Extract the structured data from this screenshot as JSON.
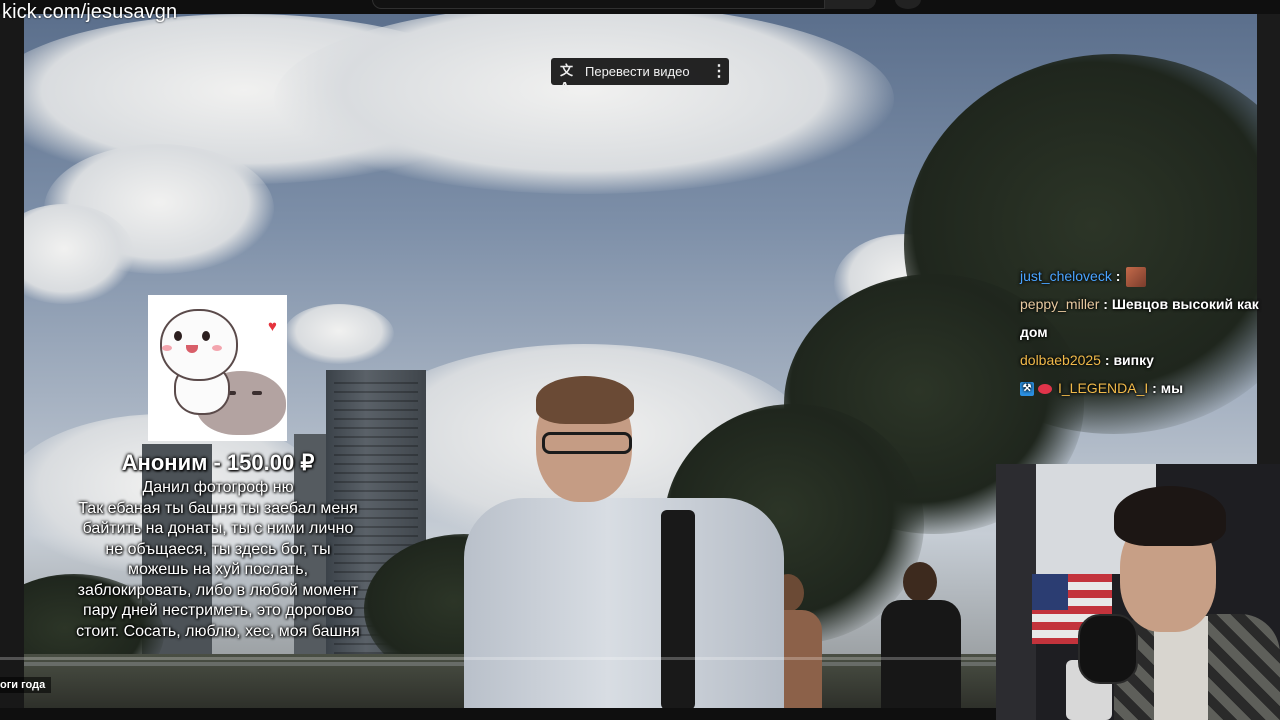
{
  "overlay": {
    "channel_url": "kick.com/jesusavgn"
  },
  "player": {
    "translate_button": {
      "icon": "translate-icon",
      "label": "Перевести видео",
      "menu_icon": "more-vert-icon"
    },
    "chapter_label": "оги года",
    "progress_fraction": 0.0
  },
  "donation": {
    "image": "cute-cats-sticker",
    "title": "Аноним - 150.00 ₽",
    "message": "Данил фотогроф ню\nТак ебаная ты башня ты заебал меня\nбайтить на донаты, ты с ними лично\nне объщаеся, ты здесь бог, ты\nможешь на хуй послать,\nзаблокировать, либо в любой момент\nпару дней нестриметь, это дорогово\nстоит. Сосать, люблю, хес, моя башня"
  },
  "chat": {
    "messages": [
      {
        "user": "just_cheloveck",
        "color": "#4aa3ff",
        "sep": " : ",
        "text": "",
        "emote": "face-emote"
      },
      {
        "user": "peppy_miller",
        "color": "#e8c9a0",
        "sep": " : ",
        "text": "Шевцов высокий как дом"
      },
      {
        "user": "dolbaeb2025",
        "color": "#f0b94a",
        "sep": " : ",
        "text": "випку"
      },
      {
        "user": "I_LEGENDA_I",
        "color": "#f0b94a",
        "sep": " : ",
        "text": "мы",
        "badges": [
          "pickaxe-badge",
          "lips-badge"
        ]
      }
    ]
  }
}
